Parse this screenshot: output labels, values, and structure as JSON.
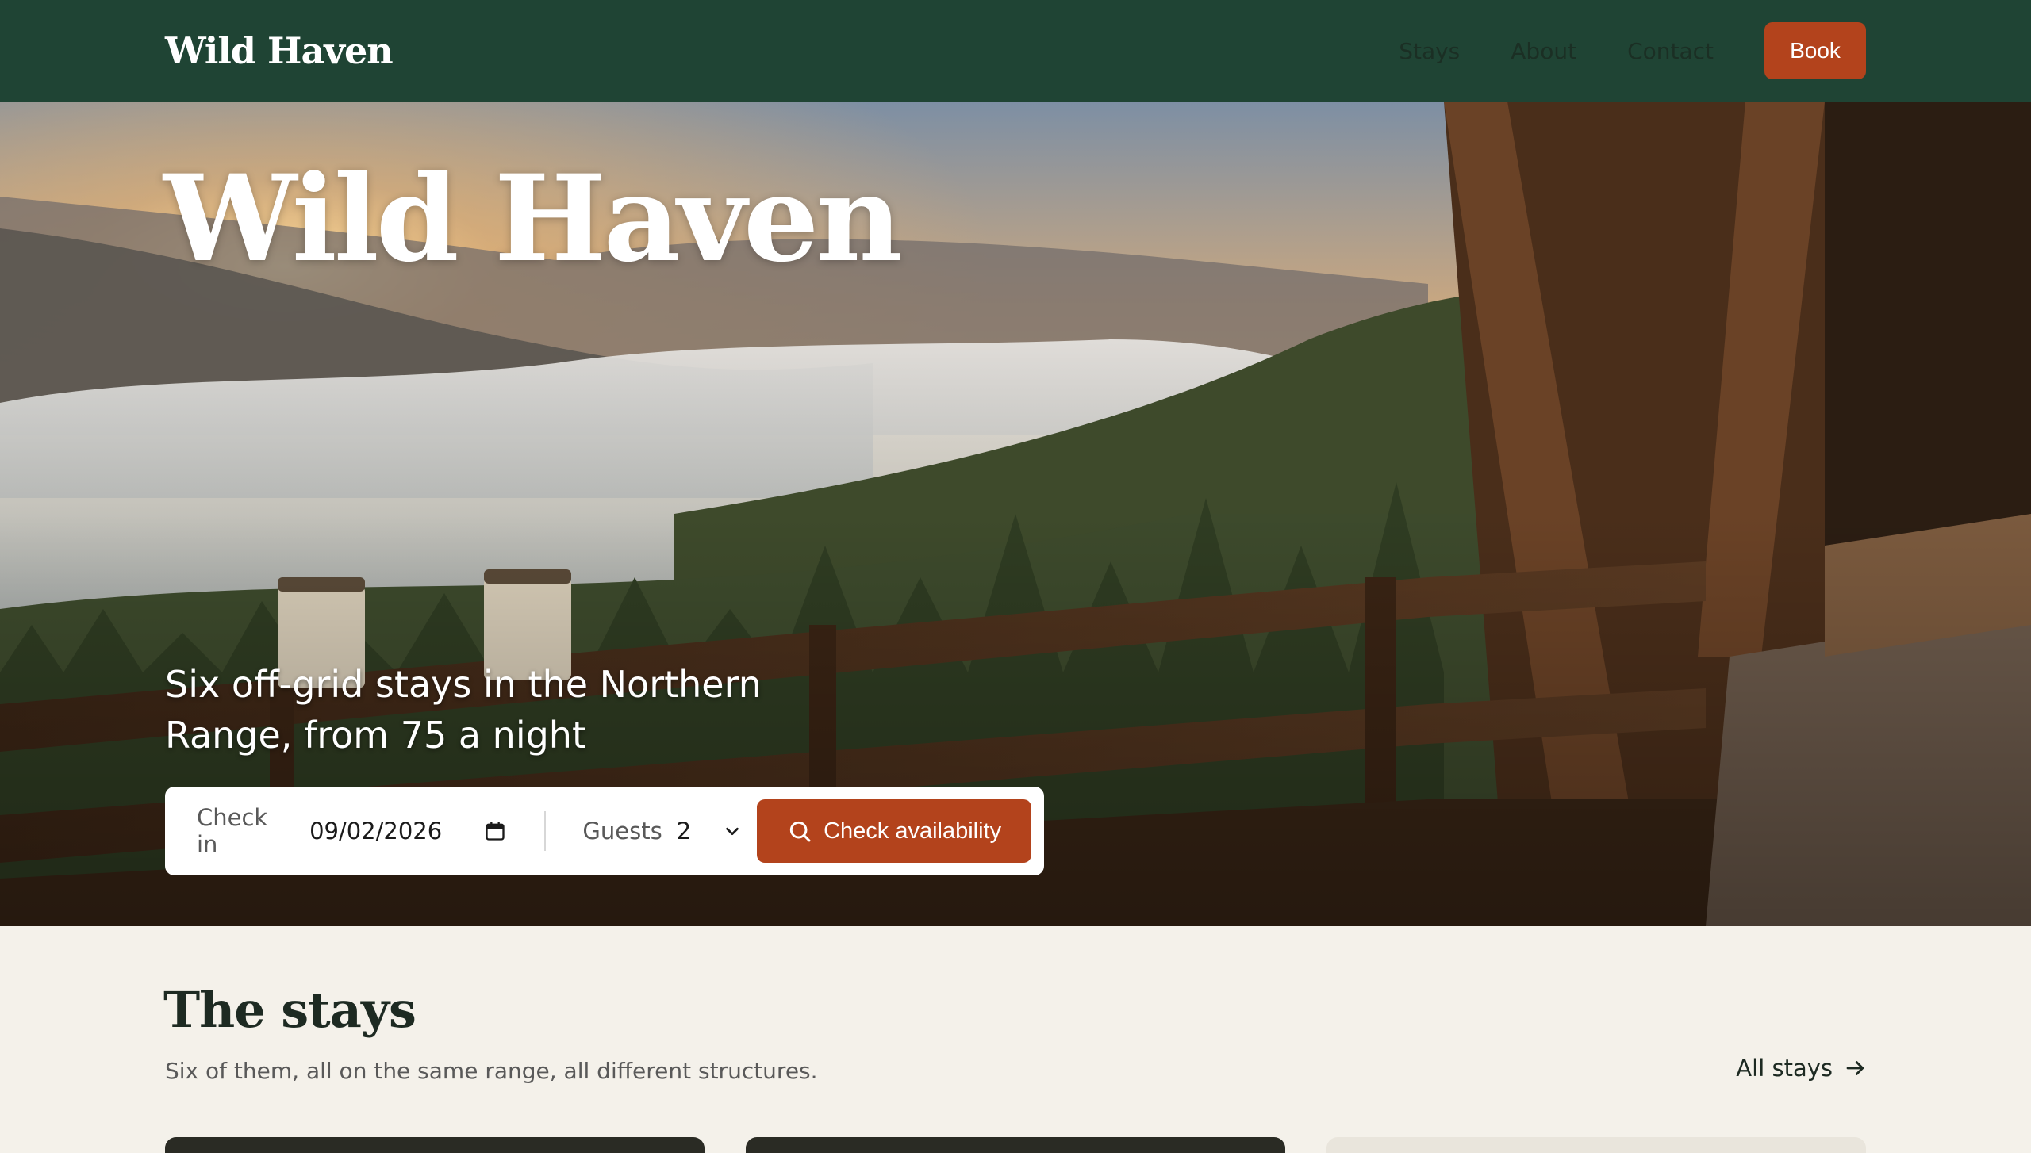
{
  "header": {
    "brand": "Wild Haven",
    "nav": [
      "Stays",
      "About",
      "Contact"
    ],
    "book_label": "Book"
  },
  "hero": {
    "title": "Wild Haven",
    "subtitle": "Six off-grid stays in the Northern Range, from 75 a night"
  },
  "booking": {
    "checkin_label": "Check in",
    "checkin_value": "09/02/2026",
    "guests_label": "Guests",
    "guests_value": "2",
    "submit_label": "Check availability"
  },
  "stays": {
    "title": "The stays",
    "subtitle": "Six of them, all on the same range, all different structures.",
    "all_link": "All stays"
  },
  "colors": {
    "header_bg": "#1f4434",
    "accent": "#b3431c",
    "page_bg": "#f4f1ea"
  },
  "icons": [
    "calendar-icon",
    "chevron-down-icon",
    "search-icon",
    "arrow-right-icon"
  ]
}
